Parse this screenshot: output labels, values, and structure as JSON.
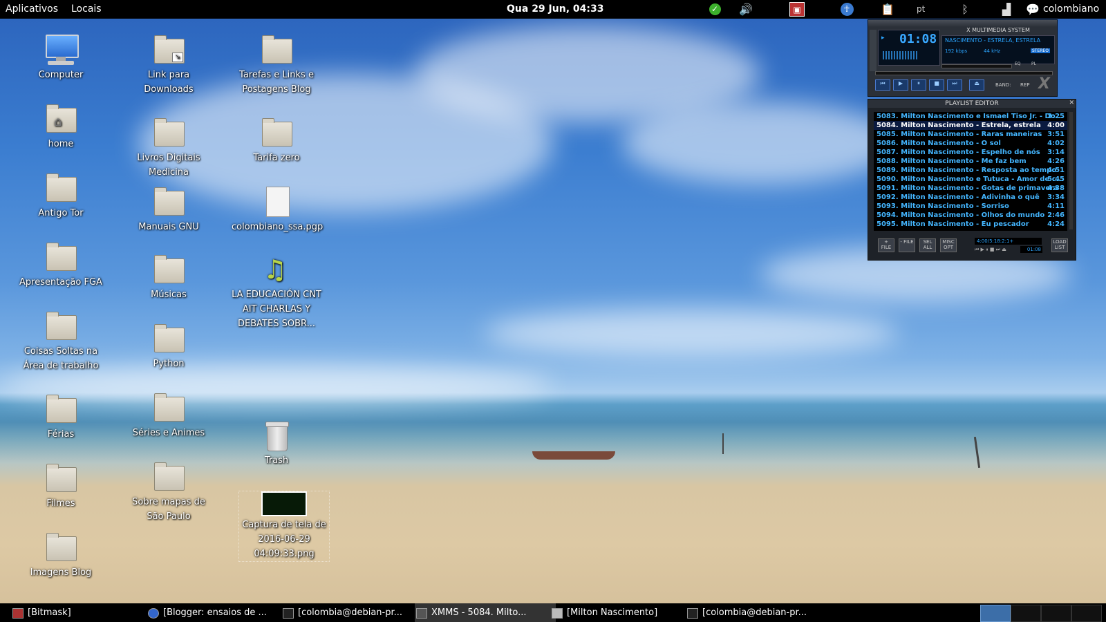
{
  "topbar": {
    "apps_menu": "Aplicativos",
    "places_menu": "Locais",
    "clock": "Qua 29 Jun, 04:33",
    "keyboard_layout": "pt",
    "username": "colombiano",
    "icons": [
      "check-icon",
      "volume-icon",
      "record-icon",
      "accessibility-icon",
      "clipboard-icon",
      "bluetooth-icon",
      "network-icon",
      "chat-icon"
    ]
  },
  "desktop": {
    "col1": [
      "Computer",
      "home",
      "Antigo Tor",
      "Apresentação FGA",
      "Coisas Soltas na Área de trabalho",
      "Férias",
      "Filmes",
      "Imagens Blog"
    ],
    "col2": [
      "Link para Downloads",
      "Livros Digitais Medicina",
      "Manuais GNU",
      "Músicas",
      "Python",
      "Séries e Animes",
      "Sobre mapas de São Paulo"
    ],
    "col3": [
      "Tarefas e Links e Postagens Blog",
      "Tarifa zero",
      "colombiano_ssa.pgp",
      "LA EDUCACIÓN CNT AIT CHARLAS Y DEBATES SOBR...",
      "Trash",
      "Captura de tela de 2016-06-29 04:09:33.png"
    ]
  },
  "xmms": {
    "title": "X MULTIMEDIA SYSTEM",
    "time": "01:08",
    "track": "NASCIMENTO - ESTRELA, ESTRELA",
    "bitrate": "192 kbps",
    "samplerate": "44 kHz",
    "stereo": "STEREO",
    "eq": "EQ",
    "pl": "PL",
    "band": "BAND:",
    "rep": "REP"
  },
  "playlist": {
    "title": "PLAYLIST EDITOR",
    "rows": [
      {
        "label": "5083. Milton Nascimento e Ismael Tiso Jr. - Do...",
        "time": "3:25"
      },
      {
        "label": "5084. Milton Nascimento - Estrela, estrela",
        "time": "4:00"
      },
      {
        "label": "5085. Milton Nascimento - Raras maneiras",
        "time": "3:51"
      },
      {
        "label": "5086. Milton Nascimento - O sol",
        "time": "4:02"
      },
      {
        "label": "5087. Milton Nascimento - Espelho de nós",
        "time": "3:14"
      },
      {
        "label": "5088. Milton Nascimento - Me faz bem",
        "time": "4:26"
      },
      {
        "label": "5089. Milton Nascimento - Resposta ao tempo",
        "time": "4:51"
      },
      {
        "label": "5090. Milton Nascimento e Tutuca - Amor de c...",
        "time": "5:45"
      },
      {
        "label": "5091. Milton Nascimento - Gotas de primavera",
        "time": "4:38"
      },
      {
        "label": "5092. Milton Nascimento - Adivinha o quê",
        "time": "3:34"
      },
      {
        "label": "5093. Milton Nascimento - Sorriso",
        "time": "4:11"
      },
      {
        "label": "5094. Milton Nascimento - Olhos do mundo",
        "time": "2:46"
      },
      {
        "label": "5095. Milton Nascimento - Eu pescador",
        "time": "4:24"
      }
    ],
    "buttons": [
      "+ FILE",
      "- FILE",
      "SEL ALL",
      "MISC OPT",
      "LOAD LIST"
    ],
    "total_time": "4:00/5:18:2:1+",
    "elapsed": "01:08"
  },
  "taskbar": {
    "tasks": [
      "[Bitmask]",
      "[Blogger: ensaios de ...",
      "[colombia@debian-pr...",
      "XMMS - 5084. Milto...",
      "[Milton Nascimento]",
      "[colombia@debian-pr..."
    ]
  }
}
